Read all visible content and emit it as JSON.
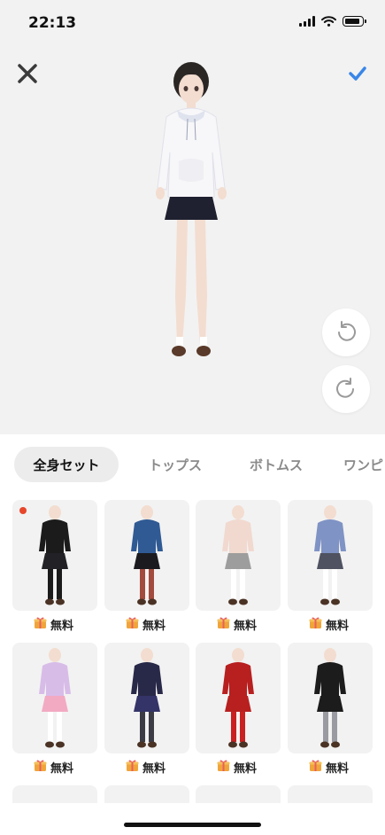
{
  "status_bar": {
    "time": "22:13"
  },
  "tabs": [
    {
      "label": "全身セット",
      "active": true
    },
    {
      "label": "トップス",
      "active": false
    },
    {
      "label": "ボトムス",
      "active": false
    },
    {
      "label": "ワンピ",
      "active": false
    }
  ],
  "outfits": [
    {
      "price": "無料",
      "new": true,
      "top": "#1b1b1b",
      "bottom": "#222226",
      "legs": "#1b1b1b"
    },
    {
      "price": "無料",
      "new": false,
      "top": "#2f5a94",
      "bottom": "#1b1b1f",
      "legs": "#a34b3e"
    },
    {
      "price": "無料",
      "new": false,
      "top": "#f1d9cf",
      "bottom": "#9d9d9d",
      "legs": "#ffffff"
    },
    {
      "price": "無料",
      "new": false,
      "top": "#7f93c4",
      "bottom": "#4f5260",
      "legs": "#ffffff"
    },
    {
      "price": "無料",
      "new": false,
      "top": "#d8bce8",
      "bottom": "#f2aac2",
      "legs": "#ffffff"
    },
    {
      "price": "無料",
      "new": false,
      "top": "#282848",
      "bottom": "#343468",
      "legs": "#3c3c46"
    },
    {
      "price": "無料",
      "new": false,
      "top": "#b81f1f",
      "bottom": "#b81f1f",
      "legs": "#c92121"
    },
    {
      "price": "無料",
      "new": false,
      "top": "#1c1c1c",
      "bottom": "#1c1c1c",
      "legs": "#9a9aa2"
    }
  ],
  "colors": {
    "accent": "#3a86e8",
    "new_badge": "#e8462b",
    "gift": "#f0a53b"
  }
}
